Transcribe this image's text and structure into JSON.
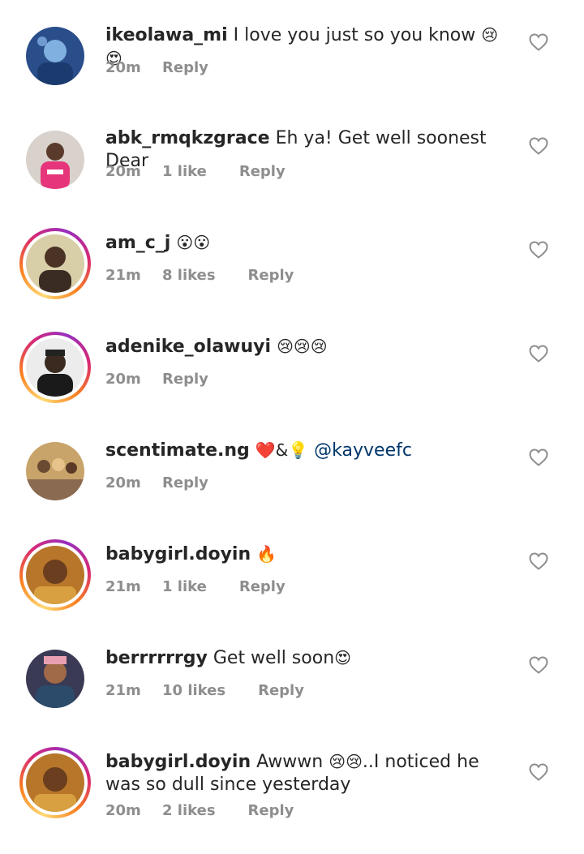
{
  "comments": [
    {
      "username": "ikeolawa_mi",
      "text": "I love you just so you know ",
      "emoji": "😢😍",
      "time": "20m",
      "likes": "",
      "reply": "Reply",
      "ring": false
    },
    {
      "username": "abk_rmqkzgrace",
      "text": "Eh ya! Get well soonest Dear",
      "emoji": "",
      "time": "20m",
      "likes": "1 like",
      "reply": "Reply",
      "ring": false
    },
    {
      "username": "am_c_j",
      "text": "",
      "emoji": "😮😮",
      "time": "21m",
      "likes": "8 likes",
      "reply": "Reply",
      "ring": true
    },
    {
      "username": "adenike_olawuyi",
      "text": "",
      "emoji": "😢😢😢",
      "time": "20m",
      "likes": "",
      "reply": "Reply",
      "ring": true
    },
    {
      "username": "scentimate.ng",
      "text": "",
      "emoji": "❤️&💡",
      "mention": "@kayveefc",
      "time": "20m",
      "likes": "",
      "reply": "Reply",
      "ring": false
    },
    {
      "username": "babygirl.doyin",
      "text": "",
      "emoji": "🔥",
      "time": "21m",
      "likes": "1 like",
      "reply": "Reply",
      "ring": true
    },
    {
      "username": "berrrrrrgy",
      "text": "Get well soon",
      "emoji": "😍",
      "time": "21m",
      "likes": "10 likes",
      "reply": "Reply",
      "ring": false
    },
    {
      "username": "babygirl.doyin",
      "text": "Awwwn ",
      "emoji": "😢😢",
      "text2": "..I noticed he was so dull since yesterday",
      "time": "20m",
      "likes": "2 likes",
      "reply": "Reply",
      "ring": true
    }
  ]
}
